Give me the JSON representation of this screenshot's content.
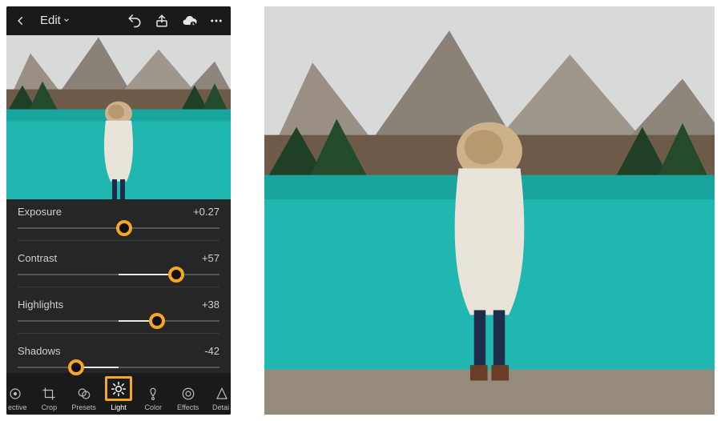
{
  "header": {
    "edit_label": "Edit"
  },
  "sliders": {
    "exposure": {
      "label": "Exposure",
      "value_text": "+0.27",
      "value": 0.27,
      "min": -5,
      "max": 5
    },
    "contrast": {
      "label": "Contrast",
      "value_text": "+57",
      "value": 57,
      "min": -100,
      "max": 100
    },
    "highlights": {
      "label": "Highlights",
      "value_text": "+38",
      "value": 38,
      "min": -100,
      "max": 100
    },
    "shadows": {
      "label": "Shadows",
      "value_text": "-42",
      "value": -42,
      "min": -100,
      "max": 100
    }
  },
  "tools": {
    "selective_cut": "ective",
    "crop": "Crop",
    "presets": "Presets",
    "light": "Light",
    "color": "Color",
    "effects": "Effects",
    "detail_cut": "Detai"
  },
  "colors": {
    "accent": "#f5a623",
    "water": "#1fb7b0",
    "sky": "#d7dad9"
  }
}
